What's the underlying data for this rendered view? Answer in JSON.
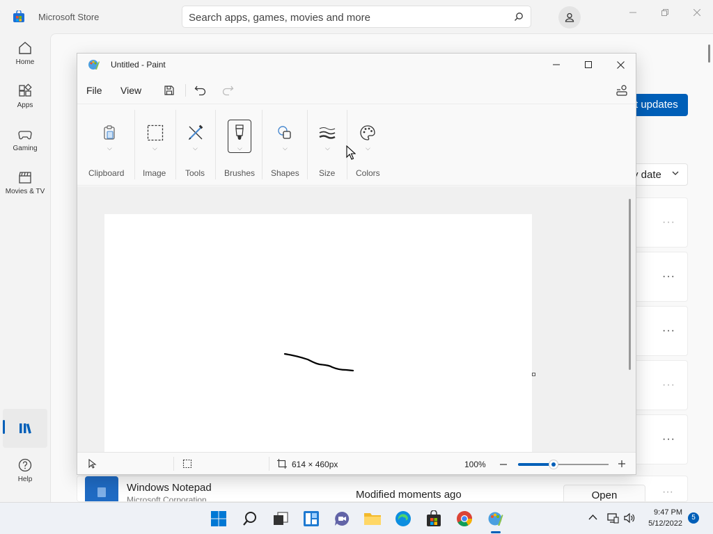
{
  "store": {
    "title": "Microsoft Store",
    "search_placeholder": "Search apps, games, movies and more",
    "nav": [
      {
        "label": "Home"
      },
      {
        "label": "Apps"
      },
      {
        "label": "Gaming"
      },
      {
        "label": "Movies & TV"
      }
    ],
    "help_label": "Help",
    "updates_button": "t updates",
    "sort_label": "y date",
    "notepad": {
      "name": "Windows Notepad",
      "publisher": "Microsoft Corporation",
      "modified": "Modified moments ago",
      "open_label": "Open"
    },
    "accent": "#005fb8"
  },
  "paint": {
    "title": "Untitled - Paint",
    "menu": {
      "file": "File",
      "view": "View"
    },
    "ribbon": {
      "clipboard": "Clipboard",
      "image": "Image",
      "tools": "Tools",
      "brushes": "Brushes",
      "shapes": "Shapes",
      "size": "Size",
      "colors": "Colors"
    },
    "status": {
      "canvas_size": "614 × 460px",
      "zoom": "100%",
      "zoom_level": 0.39
    }
  },
  "taskbar": {
    "time": "9:47 PM",
    "date": "5/12/2022",
    "notification_count": "5"
  }
}
